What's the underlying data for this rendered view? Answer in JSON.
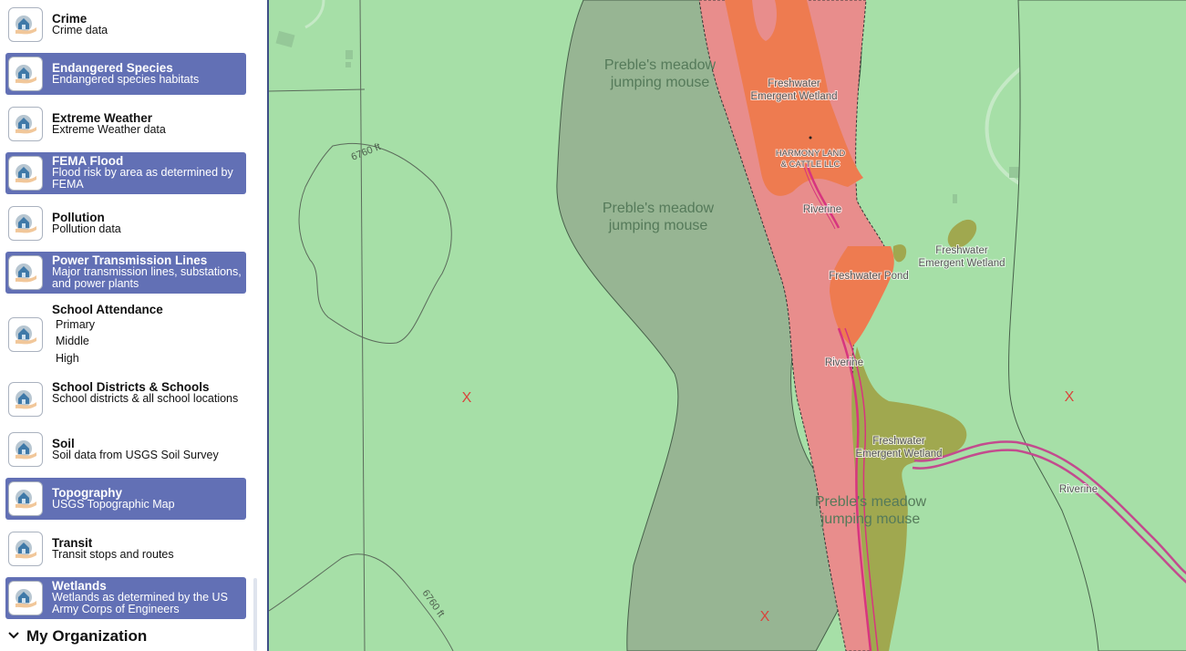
{
  "sidebar": {
    "layers": [
      {
        "title": "Crime",
        "description": "Crime data",
        "active": false
      },
      {
        "title": "Endangered Species",
        "description": "Endangered species habitats",
        "active": true
      },
      {
        "title": "Extreme Weather",
        "description": "Extreme Weather data",
        "active": false
      },
      {
        "title": "FEMA Flood",
        "description": "Flood risk by area as determined by FEMA",
        "active": true
      },
      {
        "title": "Pollution",
        "description": "Pollution data",
        "active": false
      },
      {
        "title": "Power Transmission Lines",
        "description": "Major transmission lines, substations, and power plants",
        "active": true
      },
      {
        "title": "School Attendance",
        "description": "",
        "active": false,
        "options": [
          "Primary",
          "Middle",
          "High"
        ]
      },
      {
        "title": "School Districts & Schools",
        "description": "School districts & all school locations",
        "active": false
      },
      {
        "title": "Soil",
        "description": "Soil data from USGS Soil Survey",
        "active": false
      },
      {
        "title": "Topography",
        "description": "USGS Topographic Map",
        "active": true
      },
      {
        "title": "Transit",
        "description": "Transit stops and routes",
        "active": false
      },
      {
        "title": "Wetlands",
        "description": "Wetlands as determined by the US Army Corps of Engineers",
        "active": true
      }
    ],
    "section": {
      "label": "My Organization",
      "icon": "chevron-down-icon"
    }
  },
  "map": {
    "habitat_labels": [
      {
        "line1": "Preble's meadow",
        "line2": "jumping mouse"
      },
      {
        "line1": "Preble's meadow",
        "line2": "jumping mouse"
      },
      {
        "line1": "Preble's meadow",
        "line2": "jumping mouse"
      }
    ],
    "wetland_labels": [
      {
        "line1": "Freshwater",
        "line2": "Emergent Wetland"
      },
      {
        "line1": "Riverine",
        "line2": ""
      },
      {
        "line1": "Freshwater",
        "line2": "Emergent Wetland"
      },
      {
        "line1": "Freshwater Pond",
        "line2": ""
      },
      {
        "line1": "Riverine",
        "line2": ""
      },
      {
        "line1": "Freshwater",
        "line2": "Emergent Wetland"
      },
      {
        "line1": "Riverine",
        "line2": ""
      }
    ],
    "parcel_owner": {
      "line1": "HARMONY LAND",
      "line2": "& CATTLE LLC"
    },
    "contour_labels": [
      "6760 ft",
      "6760 ft"
    ],
    "markers": [
      "X",
      "X",
      "X"
    ],
    "colors": {
      "base_green": "#a6dfa7",
      "habitat_gray": "#97b593",
      "flood_red": "#e88d8c",
      "wetland_orange": "#ee7b50",
      "riverine_olive": "#a0a84f",
      "river_line": "#d7357f",
      "active_layer": "#6270b5",
      "marker": "#d9453c"
    }
  }
}
